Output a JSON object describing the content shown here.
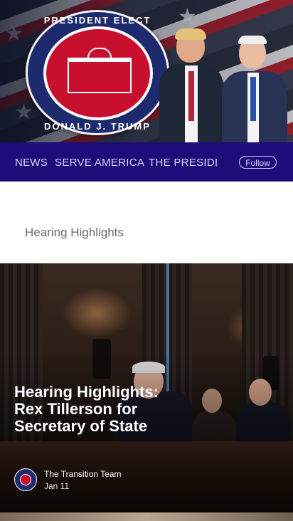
{
  "header": {
    "seal": {
      "ring_top": "PRESIDENT ELECT",
      "ring_bottom": "DONALD J. TRUMP"
    }
  },
  "nav": {
    "items": [
      "NEWS",
      "SERVE AMERICA",
      "THE PRESIDENT-ELECT"
    ],
    "follow_label": "Follow"
  },
  "section": {
    "title": "Hearing Highlights"
  },
  "post": {
    "title": "Hearing Highlights: Rex Tillerson for Secretary of State",
    "author": "The Transition Team",
    "date": "Jan 11"
  },
  "colors": {
    "nav_background": "#1f0b7a",
    "nav_text": "#d9d3f3",
    "seal_blue": "#1d2a6e",
    "seal_red": "#c8102e"
  },
  "icons": {
    "author_avatar": "seal-avatar-icon"
  }
}
